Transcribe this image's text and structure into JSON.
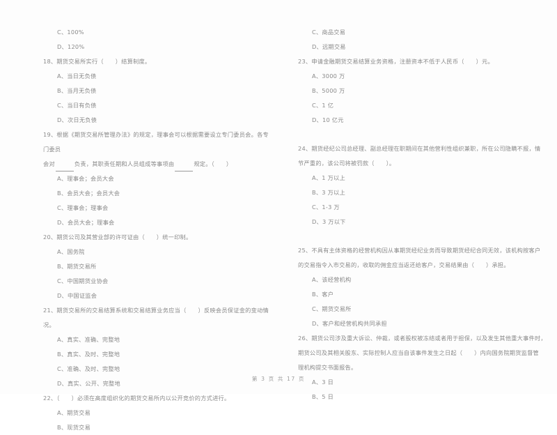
{
  "document": {
    "type": "exam-paper-scan",
    "footer": "第 3 页 共 17 页",
    "text_color": "#8a8a8a",
    "background_color": "#fdfdfd"
  },
  "left_column": {
    "carryover_options": [
      "C、100%",
      "D、120%"
    ],
    "questions": [
      {
        "number": "18",
        "stem": "18、期货交易所实行（　　）结算制度。",
        "options": [
          "A、当日无负债",
          "B、当月无负债",
          "C、当日有负债",
          "D、次日无负债"
        ]
      },
      {
        "number": "19",
        "stem_line_1": "19、根据《期货交易所管理办法》的规定，理事会可以根据需要设立专门委员会。各专门委员",
        "stem_line_2_a": "会对",
        "stem_line_2_b": "负责，其职责任期和人员组成等事项由",
        "stem_line_2_c": "规定。（　　）",
        "options": [
          "A、理事会；会员大会",
          "B、会员大会；会员大会",
          "C、理事会；理事会",
          "D、会员大会；理事会"
        ]
      },
      {
        "number": "20",
        "stem": "20、期货公司及其营业部的许可证由（　　）统一印制。",
        "options": [
          "A、国务院",
          "B、期货交易所",
          "C、中国期货业协会",
          "D、中国证监会"
        ]
      },
      {
        "number": "21",
        "stem": "21、期货交易所的交易结算系统和交易结算业务应当（　　）反映会员保证金的变动情况。",
        "options": [
          "A、真实、准确、完整地",
          "B、真实、及时、完整地",
          "C、准确、及时、完整地",
          "D、真实、公开、完整地"
        ]
      },
      {
        "number": "22",
        "stem": "22、（　　）必须在高度组织化的期货交易所内以公开竞价的方式进行。",
        "options": [
          "A、期货交易",
          "B、现货交易"
        ]
      }
    ]
  },
  "right_column": {
    "carryover_options": [
      "C、商品交易",
      "D、远期交易"
    ],
    "questions": [
      {
        "number": "23",
        "stem": "23、申请金融期货交易结算业务资格，注册资本不低于人民币（　　）元。",
        "options": [
          "A、3000 万",
          "B、5000 万",
          "C、1 亿",
          "D、10 亿元"
        ]
      },
      {
        "number": "24",
        "stem_line_1": "24、期货经纪公司总经理、副总经理在职期间在其他营利性组织兼职，所在公司隐瞒不报，情",
        "stem_line_2": "节严重的，该公司将被罚款（　　）。",
        "options": [
          "A、1 万以上",
          "B、3 万以上",
          "C、1-3 万",
          "D、3 万以下"
        ]
      },
      {
        "number": "25",
        "stem_line_1": "25、不具有主体资格的经营机构因从事期货经纪业务而导致期货经纪合同无效，该机构按客户",
        "stem_line_2": "的交易指令入市交易的，收取的佣金应当返还给客户，交易结果由（　　）承担。",
        "options": [
          "A、该经营机构",
          "B、客户",
          "C、期货交易所",
          "D、客户和经营机构共同承担"
        ]
      },
      {
        "number": "26",
        "stem_line_1": "26、期货公司涉及重大诉讼、仲裁，或者股权被冻结或者用于担保，以及发生其他重大事件时，",
        "stem_line_2": "期货公司及其相关股东、实际控制人应当自该事件发生之日起（　　）内向国务院期货监督管",
        "stem_line_3": "理机构提交书面报告。",
        "options": [
          "A、3 日",
          "B、5 日"
        ]
      }
    ]
  }
}
